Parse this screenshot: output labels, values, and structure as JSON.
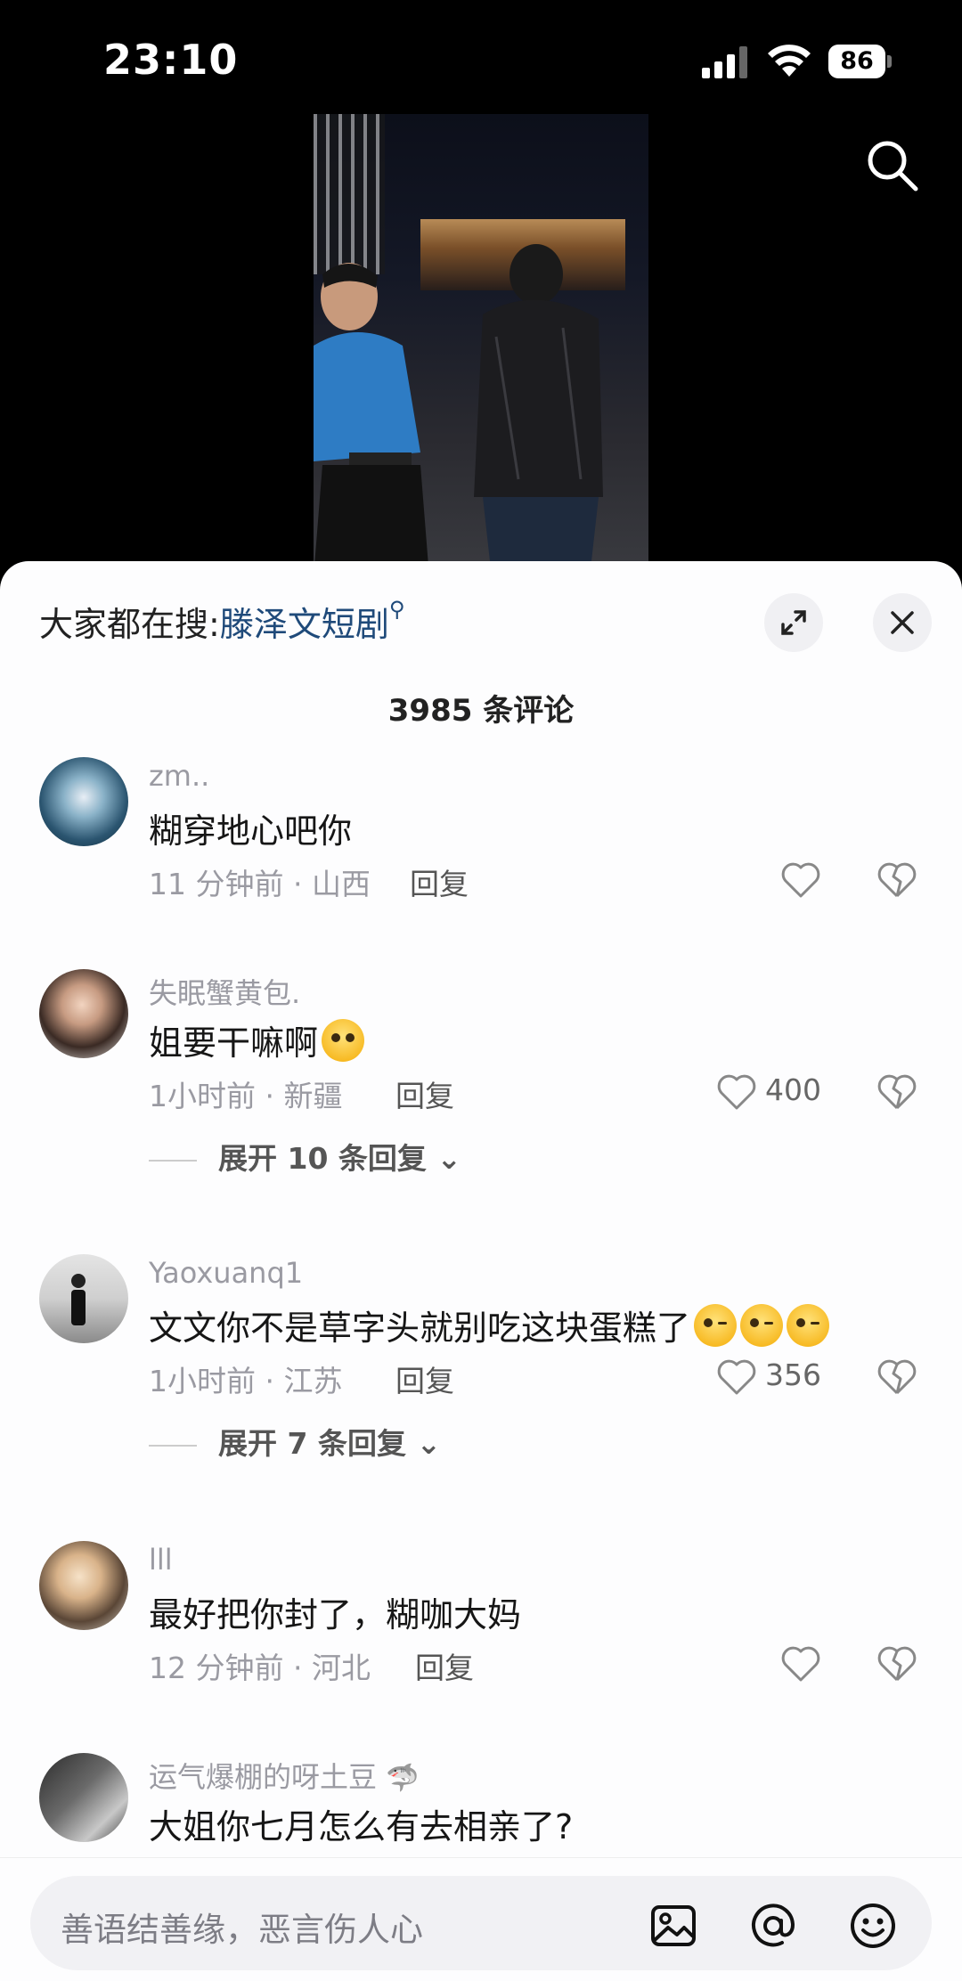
{
  "status_bar": {
    "time": "23:10",
    "battery": "86"
  },
  "sheet": {
    "trending_prefix": "大家都在搜:",
    "trending_keyword": "滕泽文短剧",
    "comment_count": "3985 条评论"
  },
  "comments": [
    {
      "user": "zm..",
      "text": "糊穿地心吧你",
      "meta": "11 分钟前 · 山西",
      "reply": "回复",
      "likes": ""
    },
    {
      "user": "失眠蟹黄包.",
      "text": "姐要干嘛啊",
      "meta": "1小时前 · 新疆",
      "reply": "回复",
      "likes": "400",
      "expand": "展开 10 条回复"
    },
    {
      "user": "Yaoxuanq1",
      "text": "文文你不是草字头就别吃这块蛋糕了",
      "meta": "1小时前 · 江苏",
      "reply": "回复",
      "likes": "356",
      "expand": "展开 7 条回复"
    },
    {
      "user": "lll",
      "text": "最好把你封了，糊咖大妈",
      "meta": "12 分钟前 · 河北",
      "reply": "回复",
      "likes": ""
    },
    {
      "user": "运气爆棚的呀土豆",
      "text": "大姐你七月怎么有去相亲了?",
      "meta": "",
      "reply": "",
      "likes": ""
    }
  ],
  "input_bar": {
    "placeholder": "善语结善缘，恶言伤人心"
  },
  "icons": [
    "search-icon",
    "expand-icon",
    "close-icon",
    "heart-icon",
    "broken-heart-icon",
    "image-icon",
    "at-icon",
    "emoji-icon",
    "chevron-down-icon",
    "shark-emoji"
  ]
}
